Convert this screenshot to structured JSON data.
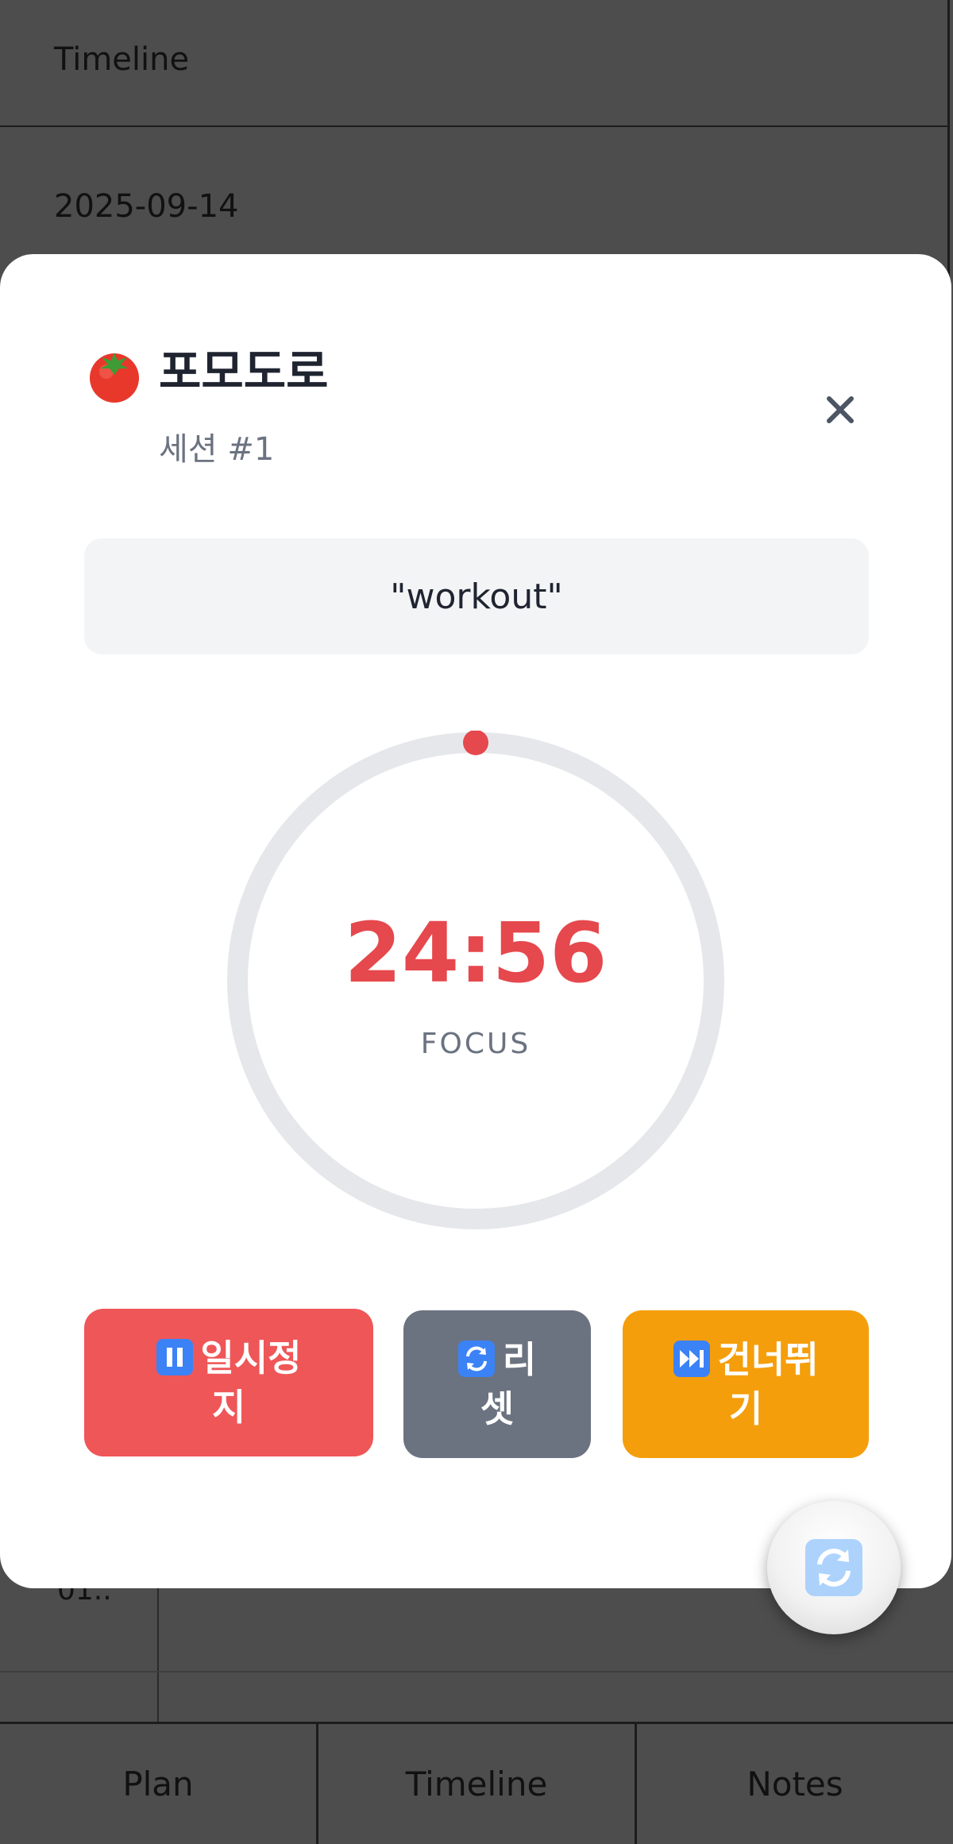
{
  "background": {
    "header_title": "Timeline",
    "date": "2025-09-14",
    "hidden_row_text": "01..",
    "tabs": [
      {
        "label": "Plan"
      },
      {
        "label": "Timeline"
      },
      {
        "label": "Notes"
      }
    ]
  },
  "modal": {
    "title": "포모도로",
    "title_icon": "tomato-icon",
    "subtitle": "세션 #1",
    "close_icon": "close-icon",
    "task": "\"workout\"",
    "timer": {
      "time": "24:56",
      "mode": "FOCUS",
      "progress_fraction": 0.0
    },
    "buttons": {
      "pause_line1": "일시정",
      "pause_line2": "지",
      "reset_line1": "리",
      "reset_line2": "셋",
      "skip_line1": "건너뛰",
      "skip_line2": "기"
    },
    "colors": {
      "accent_red": "#e5484d",
      "pause_bg": "#ef5658",
      "reset_bg": "#6b7280",
      "skip_bg": "#f59e0b"
    }
  },
  "fab": {
    "icon": "refresh-icon"
  }
}
